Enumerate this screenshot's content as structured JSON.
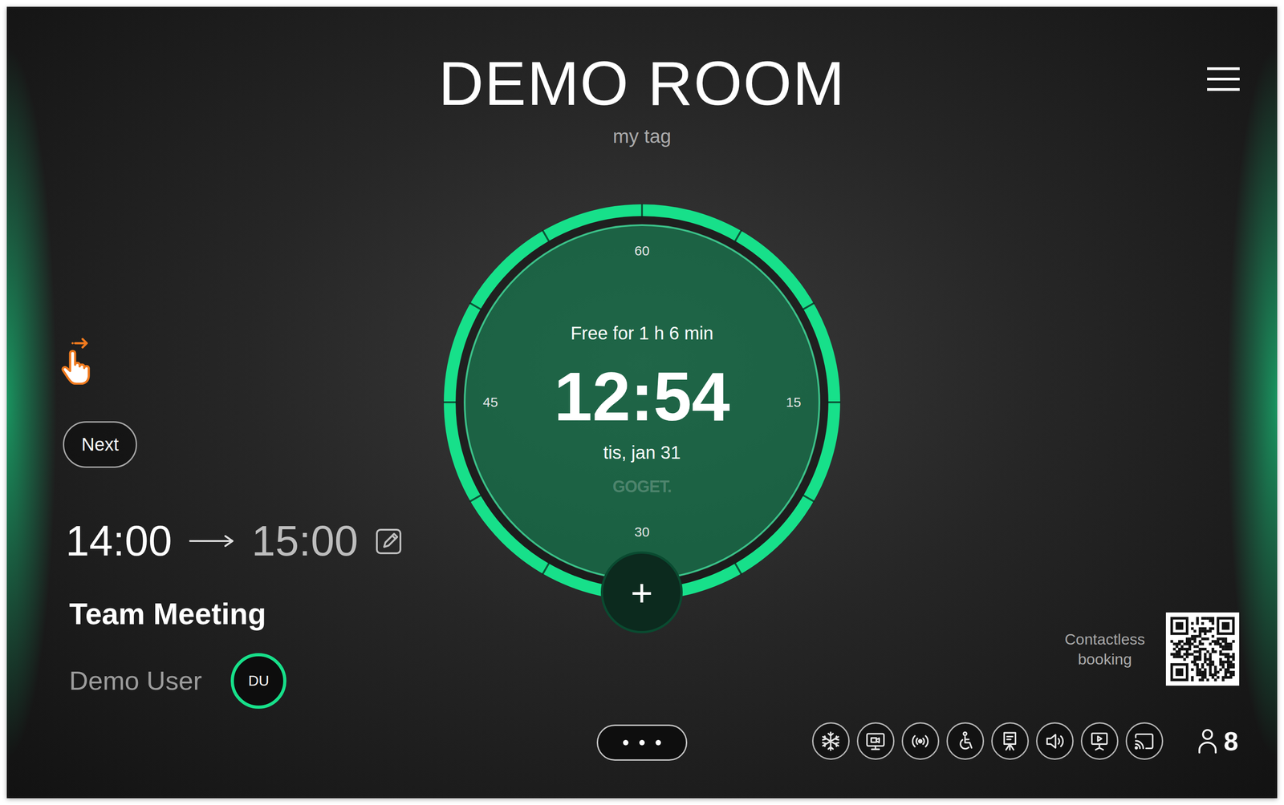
{
  "header": {
    "title": "DEMO ROOM",
    "tag": "my tag"
  },
  "clock": {
    "status": "Free for 1 h 6 min",
    "time": "12:54",
    "date": "tis, jan 31",
    "logo": "GOGET.",
    "ticks": [
      "60",
      "15",
      "30",
      "45"
    ],
    "add_button": "+"
  },
  "next_meeting": {
    "button": "Next",
    "start": "14:00",
    "end": "15:00",
    "title": "Team Meeting",
    "organizer": "Demo User",
    "initials": "DU"
  },
  "contactless": {
    "label": "Contactless booking"
  },
  "capacity": "8"
}
